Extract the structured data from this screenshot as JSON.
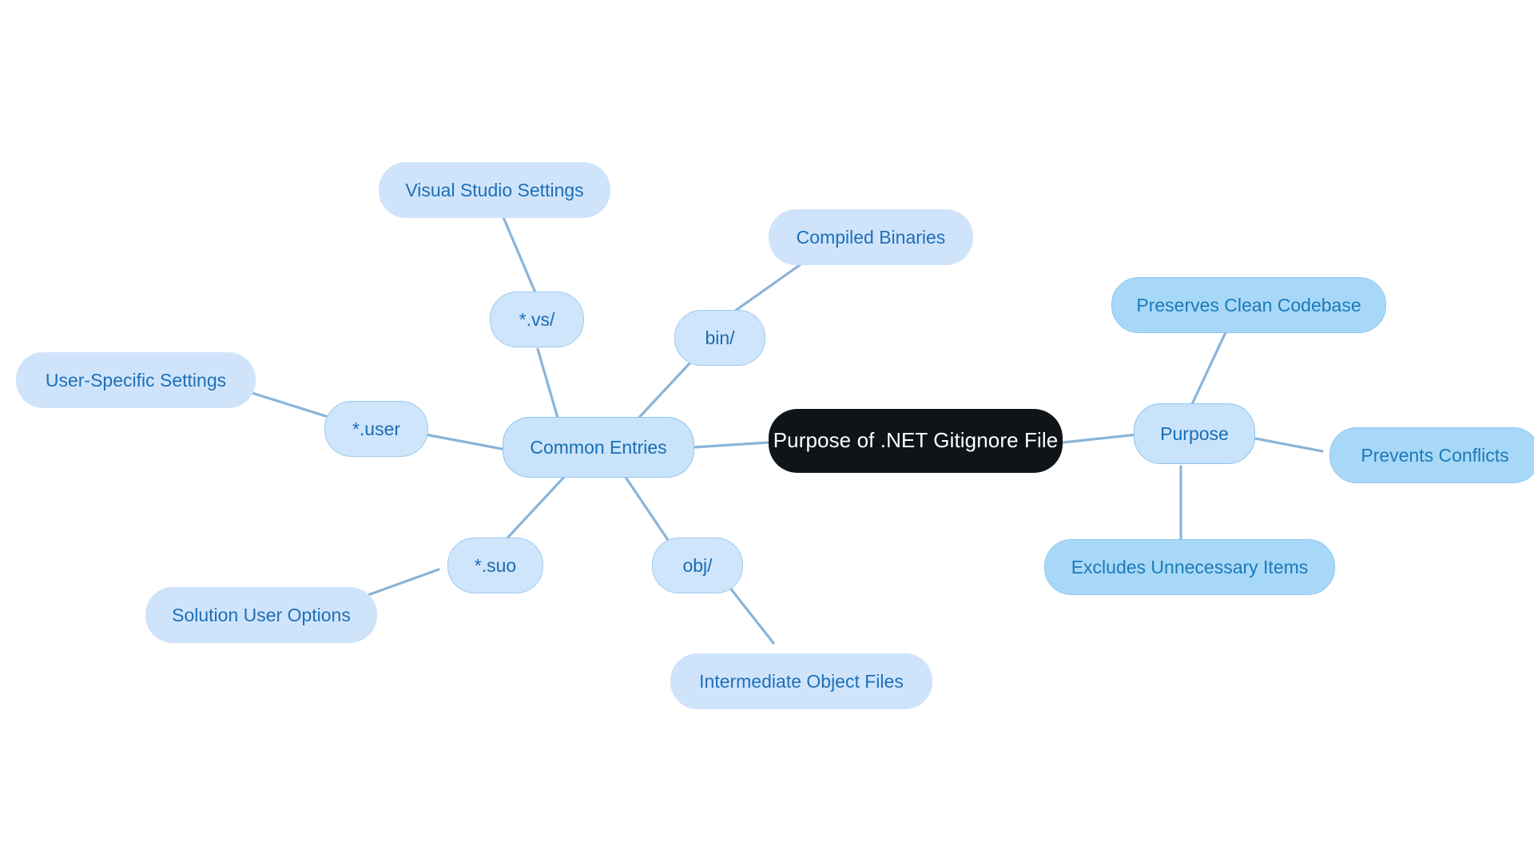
{
  "diagram": {
    "type": "mindmap",
    "title": "Purpose of .NET Gitignore File",
    "background": "#ffffff",
    "edge_color": "#8ab4d8",
    "colors": {
      "root_fill": "#0f1419",
      "root_text": "#ffffff",
      "branch_fill": "#c9e3fb",
      "branch_text": "#1a6fb5",
      "leaf_left_fill": "#cfe4fb",
      "leaf_right_fill": "#a8d8f8",
      "node_text": "#1b6cb3"
    }
  },
  "nodes": {
    "root": {
      "label": "Purpose of .NET Gitignore File"
    },
    "common_entries": {
      "label": "Common Entries"
    },
    "purpose": {
      "label": "Purpose"
    },
    "vs_folder": {
      "label": "*.vs/"
    },
    "visual_studio_settings": {
      "label": "Visual Studio Settings"
    },
    "bin_folder": {
      "label": "bin/"
    },
    "compiled_binaries": {
      "label": "Compiled Binaries"
    },
    "user_file": {
      "label": "*.user"
    },
    "user_specific_settings": {
      "label": "User-Specific Settings"
    },
    "suo_file": {
      "label": "*.suo"
    },
    "solution_user_options": {
      "label": "Solution User Options"
    },
    "obj_folder": {
      "label": "obj/"
    },
    "intermediate_object_files": {
      "label": "Intermediate Object Files"
    },
    "preserves_clean_codebase": {
      "label": "Preserves Clean Codebase"
    },
    "prevents_conflicts": {
      "label": "Prevents Conflicts"
    },
    "excludes_unnecessary_items": {
      "label": "Excludes Unnecessary Items"
    }
  },
  "edges": [
    {
      "from": "root",
      "to": "common_entries"
    },
    {
      "from": "root",
      "to": "purpose"
    },
    {
      "from": "common_entries",
      "to": "vs_folder"
    },
    {
      "from": "vs_folder",
      "to": "visual_studio_settings"
    },
    {
      "from": "common_entries",
      "to": "bin_folder"
    },
    {
      "from": "bin_folder",
      "to": "compiled_binaries"
    },
    {
      "from": "common_entries",
      "to": "user_file"
    },
    {
      "from": "user_file",
      "to": "user_specific_settings"
    },
    {
      "from": "common_entries",
      "to": "suo_file"
    },
    {
      "from": "suo_file",
      "to": "solution_user_options"
    },
    {
      "from": "common_entries",
      "to": "obj_folder"
    },
    {
      "from": "obj_folder",
      "to": "intermediate_object_files"
    },
    {
      "from": "purpose",
      "to": "preserves_clean_codebase"
    },
    {
      "from": "purpose",
      "to": "prevents_conflicts"
    },
    {
      "from": "purpose",
      "to": "excludes_unnecessary_items"
    }
  ]
}
